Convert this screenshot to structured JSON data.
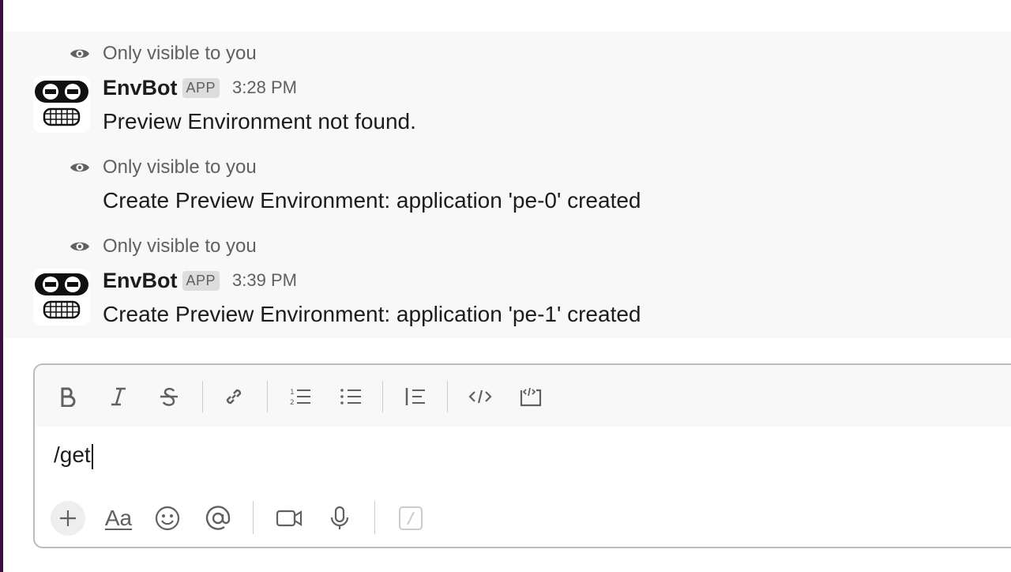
{
  "messages": [
    {
      "visibility": "Only visible to you",
      "sender": "EnvBot",
      "badge": "APP",
      "time": "3:28 PM",
      "text": "Preview Environment not found."
    },
    {
      "visibility": "Only visible to you",
      "text": "Create Preview Environment: application 'pe-0' created"
    },
    {
      "visibility": "Only visible to you",
      "sender": "EnvBot",
      "badge": "APP",
      "time": "3:39 PM",
      "text": "Create Preview Environment: application 'pe-1' created"
    }
  ],
  "composer": {
    "value": "/get",
    "format_tools": [
      "bold-icon",
      "italic-icon",
      "strikethrough-icon",
      "link-icon",
      "ordered-list-icon",
      "bulleted-list-icon",
      "blockquote-icon",
      "code-icon",
      "code-block-icon"
    ],
    "bottom_tools": [
      "plus-icon",
      "format-text-icon",
      "emoji-icon",
      "mention-icon",
      "video-icon",
      "microphone-icon",
      "slash-command-icon"
    ],
    "format_label": "Aa"
  },
  "colors": {
    "sidebar_accent": "#3f0e40",
    "message_bg": "#f8f8f8",
    "muted_text": "#616061"
  }
}
